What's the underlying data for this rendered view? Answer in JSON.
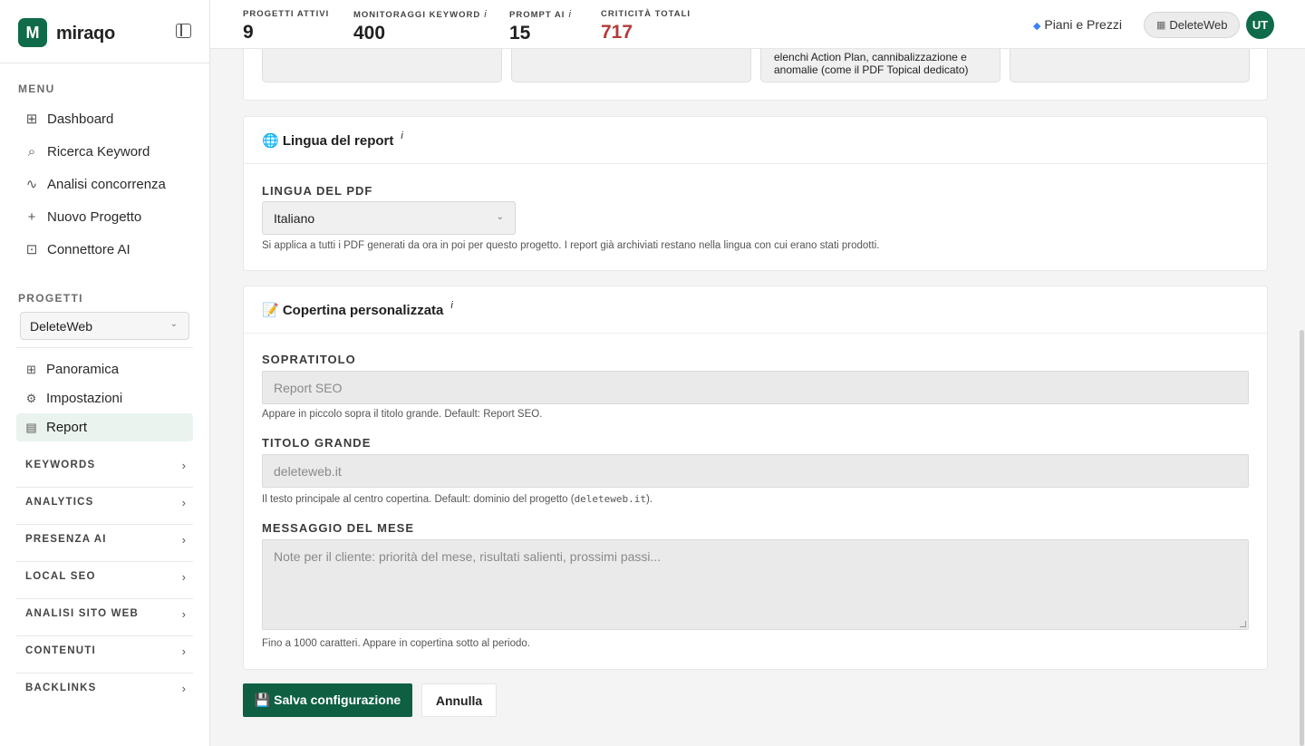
{
  "brand": {
    "logo_letter": "M",
    "name": "miraqo"
  },
  "sidebar": {
    "menu_label": "MENU",
    "menu": [
      {
        "icon": "dashboard-grid-icon",
        "glyph": "⊞",
        "label": "Dashboard"
      },
      {
        "icon": "search-plus-icon",
        "glyph": "⌕",
        "label": "Ricerca Keyword"
      },
      {
        "icon": "chart-line-icon",
        "glyph": "∿",
        "label": "Analisi concorrenza"
      },
      {
        "icon": "plus-icon",
        "glyph": "+",
        "label": "Nuovo Progetto"
      },
      {
        "icon": "robot-icon",
        "glyph": "⊡",
        "label": "Connettore AI"
      }
    ],
    "projects_label": "PROGETTI",
    "project_selected": "DeleteWeb",
    "project_items": [
      {
        "icon": "grid-icon",
        "glyph": "⊞",
        "label": "Panoramica"
      },
      {
        "icon": "gear-icon",
        "glyph": "⚙",
        "label": "Impostazioni"
      },
      {
        "icon": "document-icon",
        "glyph": "▤",
        "label": "Report"
      }
    ],
    "groups": [
      "KEYWORDS",
      "ANALYTICS",
      "PRESENZA AI",
      "LOCAL SEO",
      "ANALISI SITO WEB",
      "CONTENUTI",
      "BACKLINKS"
    ]
  },
  "topbar": {
    "stats": [
      {
        "label": "PROGETTI ATTIVI",
        "value": "9",
        "info": "",
        "color": "#1f1f1f"
      },
      {
        "label": "MONITORAGGI KEYWORD",
        "value": "400",
        "info": "i",
        "color": "#1f1f1f"
      },
      {
        "label": "PROMPT AI",
        "value": "15",
        "info": "i",
        "color": "#1f1f1f"
      },
      {
        "label": "CRITICITÀ TOTALI",
        "value": "717",
        "info": "",
        "color": "#b43a3a"
      }
    ],
    "plans_link": "Piani e Prezzi",
    "account_button": "DeleteWeb",
    "avatar_initials": "UT"
  },
  "top_tiles": {
    "tile3_text": "elenchi Action Plan, cannibalizzazione e anomalie (come il PDF Topical dedicato)"
  },
  "language_card": {
    "title": "🌐 Lingua del report",
    "info": "i",
    "field_label": "LINGUA DEL PDF",
    "selected": "Italiano",
    "help": "Si applica a tutti i PDF generati da ora in poi per questo progetto. I report già archiviati restano nella lingua con cui erano stati prodotti."
  },
  "cover_card": {
    "title": "📝 Copertina personalizzata",
    "info": "i",
    "subtitle_label": "SOPRATITOLO",
    "subtitle_placeholder": "Report SEO",
    "subtitle_help": "Appare in piccolo sopra il titolo grande. Default: Report SEO.",
    "title_label": "TITOLO GRANDE",
    "title_placeholder": "deleteweb.it",
    "title_help_prefix": "Il testo principale al centro copertina. Default: dominio del progetto (",
    "title_help_code": "deleteweb.it",
    "title_help_suffix": ").",
    "message_label": "MESSAGGIO DEL MESE",
    "message_placeholder": "Note per il cliente: priorità del mese, risultati salienti, prossimi passi...",
    "message_help": "Fino a 1000 caratteri. Appare in copertina sotto al periodo."
  },
  "actions": {
    "save": "💾 Salva configurazione",
    "cancel": "Annulla"
  }
}
